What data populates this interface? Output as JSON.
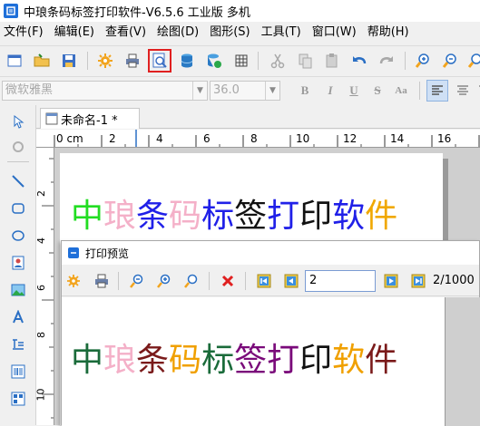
{
  "window": {
    "title": "中琅条码标签打印软件-V6.5.6 工业版 多机"
  },
  "menu": {
    "items": [
      "文件(F)",
      "编辑(E)",
      "查看(V)",
      "绘图(D)",
      "图形(S)",
      "工具(T)",
      "窗口(W)",
      "帮助(H)"
    ]
  },
  "format_bar": {
    "font_name": "微软雅黑",
    "font_size": "36.0",
    "bold": "B",
    "italic": "I",
    "underline": "U",
    "strike": "S",
    "case": "Aa"
  },
  "document": {
    "tab_label": "未命名-1 *"
  },
  "ruler": {
    "h_labels": [
      "0 cm",
      "2",
      "4",
      "6",
      "8",
      "10",
      "12",
      "14",
      "16"
    ],
    "v_labels": [
      "2",
      "4",
      "6",
      "8",
      "10"
    ]
  },
  "label_text": {
    "chars": [
      "中",
      "琅",
      "条",
      "码",
      "标",
      "签",
      "打",
      "印",
      "软",
      "件"
    ],
    "design_colors": [
      "#22dd22",
      "#f4b0c8",
      "#2020e8",
      "#f4b0c8",
      "#2020e8",
      "#111111",
      "#2020e8",
      "#111111",
      "#2020e8",
      "#f0a800"
    ],
    "preview_colors": [
      "#1a6b3a",
      "#f4b0c8",
      "#7a1a1a",
      "#f0a000",
      "#1a6b3a",
      "#7a0a7a",
      "#7a0a7a",
      "#111111",
      "#f0a000",
      "#7a1a1a"
    ]
  },
  "preview_dialog": {
    "title": "打印预览",
    "page_input": "2",
    "page_count": "2/1000"
  },
  "colors": {
    "highlight_border": "#e02020",
    "accent": "#1e6fd9"
  }
}
